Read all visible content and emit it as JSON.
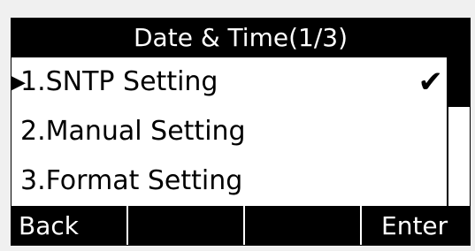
{
  "window": {
    "title": "Date & Time(1/3)"
  },
  "menu": {
    "items": [
      {
        "label": "1.SNTP Setting",
        "selected": true,
        "checked": true
      },
      {
        "label": "2.Manual Setting",
        "selected": false,
        "checked": false
      },
      {
        "label": "3.Format Setting",
        "selected": false,
        "checked": false
      }
    ],
    "selector_icon": "triangle-pointer-icon",
    "check_icon": "checkmark-icon"
  },
  "softkeys": {
    "back": "Back",
    "slot2": "",
    "slot3": "",
    "enter": "Enter"
  },
  "colors": {
    "background": "#000000",
    "foreground": "#ffffff",
    "text": "#000000"
  }
}
